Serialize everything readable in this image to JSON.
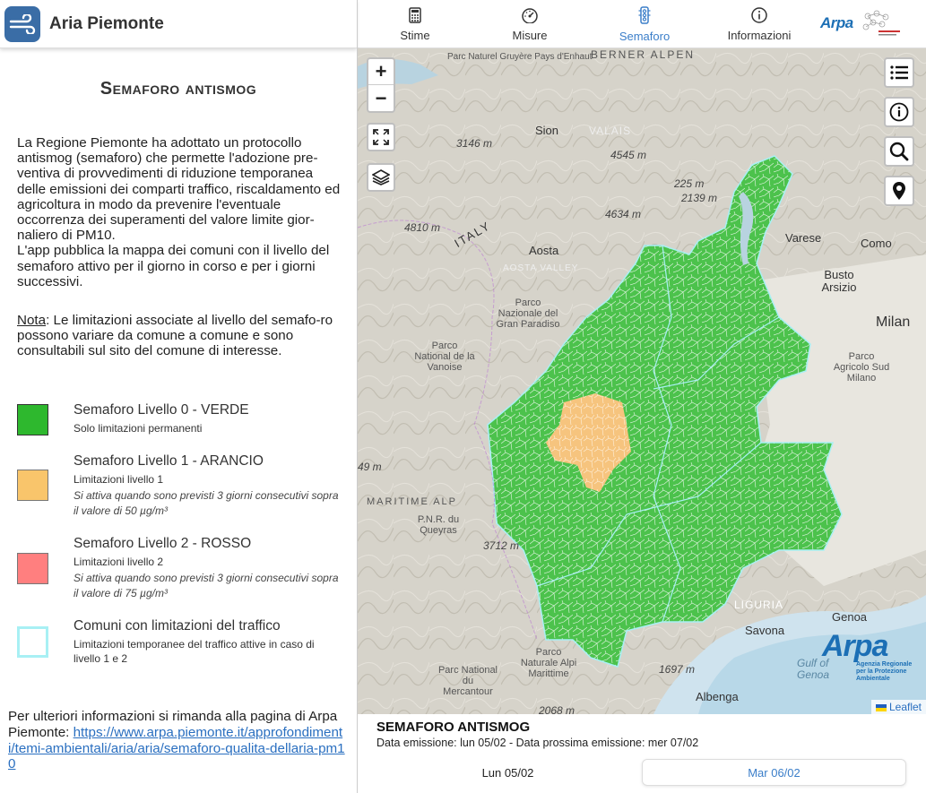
{
  "app": {
    "title": "Aria Piemonte"
  },
  "nav": [
    {
      "label": "Stime",
      "icon": "calculator-icon",
      "active": false
    },
    {
      "label": "Misure",
      "icon": "gauge-icon",
      "active": false
    },
    {
      "label": "Semaforo",
      "icon": "traffic-light-icon",
      "active": true
    },
    {
      "label": "Informazioni",
      "icon": "info-icon",
      "active": false
    }
  ],
  "partners": {
    "arpa": "Arpa"
  },
  "panel": {
    "heading": "Semaforo antismog",
    "intro": "La Regione Piemonte ha adottato un protocollo antismog (semaforo) che permette l'adozione pre-ventiva di provvedimenti di riduzione temporanea delle emissioni dei comparti traffico, riscaldamento ed agricoltura in modo da prevenire l'eventuale occorrenza dei superamenti del valore limite gior-naliero di PM10.",
    "intro2": "L'app pubblica la mappa dei comuni con il livello del semaforo attivo per il giorno in corso e per i giorni successivi.",
    "nota_label": "Nota",
    "nota_text": ": Le limitazioni associate al livello del semafo-ro possono variare da comune a comune e sono consultabili sul sito del comune di interesse."
  },
  "legend": [
    {
      "title": "Semaforo Livello 0 - VERDE",
      "sub": "Solo limitazioni permanenti",
      "note": "",
      "color": "#2eb82e"
    },
    {
      "title": "Semaforo Livello 1 - ARANCIO",
      "sub": "Limitazioni livello 1",
      "note": "Si attiva quando sono previsti 3 giorni consecutivi sopra il valore di 50 µg/m³",
      "color": "#f9c56b"
    },
    {
      "title": "Semaforo Livello 2 - ROSSO",
      "sub": "Limitazioni livello 2",
      "note": "Si attiva quando sono previsti 3 giorni consecutivi sopra il valore di 75 µg/m³",
      "color": "#ff7f7f"
    },
    {
      "title": "Comuni con limitazioni del traffico",
      "sub": "Limitazioni temporanee del traffico attive in caso di livello 1 e 2",
      "note": "",
      "color": "#a8f0f4"
    }
  ],
  "footer": {
    "text": "Per ulteriori informazioni si rimanda alla pagina di Arpa Piemonte: ",
    "link": "https://www.arpa.piemonte.it/approfondimenti/temi-ambientali/aria/aria/semaforo-qualita-dellaria-pm10"
  },
  "map": {
    "zoom_in": "+",
    "zoom_out": "−",
    "labels": {
      "aosta": "Aosta",
      "aosta_valley": "AOSTA VALLEY",
      "italy": "ITALY",
      "sion": "Sion",
      "valais": "VALAIS",
      "milan": "Milan",
      "varese": "Varese",
      "como": "Como",
      "busto": "Busto Arsizio",
      "genova": "Genoa",
      "savona": "Savona",
      "albenga": "Albenga",
      "liguria": "LIGURIA",
      "gran_paradiso": "Parco Nazionale del Gran Paradiso",
      "vanoise": "Parco National de la Vanoise",
      "pnr_queyras": "P.N.R. du Queyras",
      "mercantour": "Parc National du Mercantour",
      "alpi_marittime": "Parco Naturale Alpi Marittime",
      "agricolo_sud": "Parco Agricolo Sud Milano",
      "bernese": "BERNER ALPEN",
      "maritime_alps": "MARITIME ALP",
      "gulf": "Gulf of Genoa",
      "parc_gruyere": "Parc Naturel Gruyère Pays d'Enhaut",
      "m3146": "3146 m",
      "m4545": "4545 m",
      "m4634": "4634 m",
      "m4810": "4810 m",
      "m2139": "2139 m",
      "m225": "225 m",
      "m3712": "3712 m",
      "m1697": "1697 m",
      "m2068": "2068 m",
      "m49": "49 m"
    },
    "logo": "Arpa",
    "logo_sub": "Agenzia Regionale per la Protezione Ambientale",
    "attribution": "Leaflet"
  },
  "bottom": {
    "title": "SEMAFORO ANTISMOG",
    "subtitle": "Data emissione: lun 05/02 - Data prossima emissione: mer 07/02",
    "tabs": [
      "Lun 05/02",
      "Mar 06/02"
    ]
  }
}
